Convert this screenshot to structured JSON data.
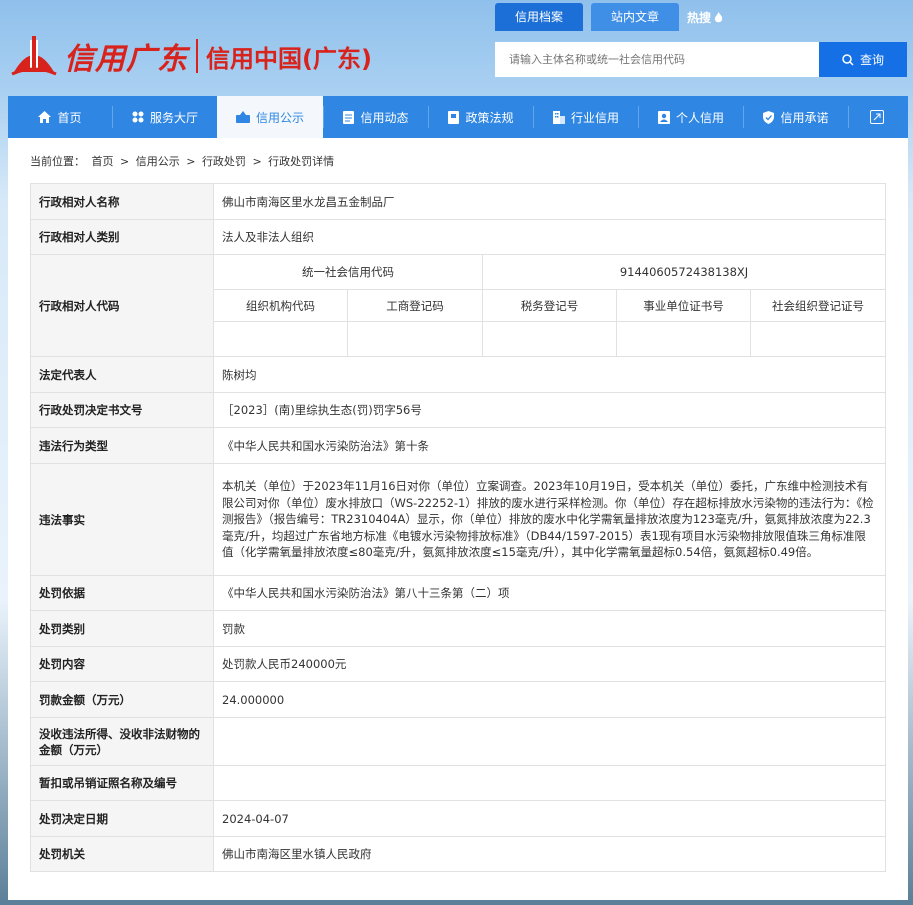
{
  "header": {
    "logo_text": "信用广东",
    "logo_sub": "信用中国(广东)",
    "top_tabs": [
      "信用档案",
      "站内文章"
    ],
    "hot_label": "热搜",
    "search_placeholder": "请输入主体名称或统一社会信用代码",
    "search_button": "查询"
  },
  "nav": {
    "items": [
      {
        "label": "首页",
        "icon": "home-icon"
      },
      {
        "label": "服务大厅",
        "icon": "grid-icon"
      },
      {
        "label": "信用公示",
        "icon": "publicity-icon"
      },
      {
        "label": "信用动态",
        "icon": "news-icon"
      },
      {
        "label": "政策法规",
        "icon": "book-icon"
      },
      {
        "label": "行业信用",
        "icon": "building-icon"
      },
      {
        "label": "个人信用",
        "icon": "person-card-icon"
      },
      {
        "label": "信用承诺",
        "icon": "shield-icon"
      }
    ],
    "active_index": 2,
    "accent": "#2f86e3"
  },
  "breadcrumb": [
    "当前位置：",
    "首页",
    ">",
    "信用公示",
    ">",
    "行政处罚",
    ">",
    "行政处罚详情"
  ],
  "detail": {
    "name_label": "行政相对人名称",
    "name_value": "佛山市南海区里水龙昌五金制品厂",
    "category_label": "行政相对人类别",
    "category_value": "法人及非法人组织",
    "code_label": "行政相对人代码",
    "uscc_label": "统一社会信用代码",
    "uscc_value": "9144060572438138XJ",
    "sub_codes": [
      "组织机构代码",
      "工商登记码",
      "税务登记号",
      "事业单位证书号",
      "社会组织登记证号"
    ],
    "legal_rep_label": "法定代表人",
    "legal_rep_value": "陈树均",
    "doc_no_label": "行政处罚决定书文号",
    "doc_no_value": "［2023］(南)里综执生态(罚)罚字56号",
    "violation_type_label": "违法行为类型",
    "violation_type_value": "《中华人民共和国水污染防治法》第十条",
    "facts_label": "违法事实",
    "facts_value": "本机关（单位）于2023年11月16日对你（单位）立案调查。2023年10月19日，受本机关（单位）委托，广东维中检测技术有限公司对你（单位）废水排放口（WS-22252-1）排放的废水进行采样检测。你（单位）存在超标排放水污染物的违法行为：《检测报告》（报告编号：TR2310404A）显示，你（单位）排放的废水中化学需氧量排放浓度为123毫克/升，氨氮排放浓度为22.3毫克/升，均超过广东省地方标准《电镀水污染物排放标准》（DB44/1597-2015）表1现有项目水污染物排放限值珠三角标准限值（化学需氧量排放浓度≤80毫克/升，氨氮排放浓度≤15毫克/升），其中化学需氧量超标0.54倍，氨氮超标0.49倍。",
    "basis_label": "处罚依据",
    "basis_value": "《中华人民共和国水污染防治法》第八十三条第（二）项",
    "penalty_type_label": "处罚类别",
    "penalty_type_value": "罚款",
    "penalty_content_label": "处罚内容",
    "penalty_content_value": "处罚款人民币240000元",
    "fine_label": "罚款金额（万元）",
    "fine_value": "24.000000",
    "confiscation_label": "没收违法所得、没收非法财物的金额（万元）",
    "confiscation_value": "",
    "license_label": "暂扣或吊销证照名称及编号",
    "license_value": "",
    "date_label": "处罚决定日期",
    "date_value": "2024-04-07",
    "authority_label": "处罚机关",
    "authority_value": "佛山市南海区里水镇人民政府"
  }
}
